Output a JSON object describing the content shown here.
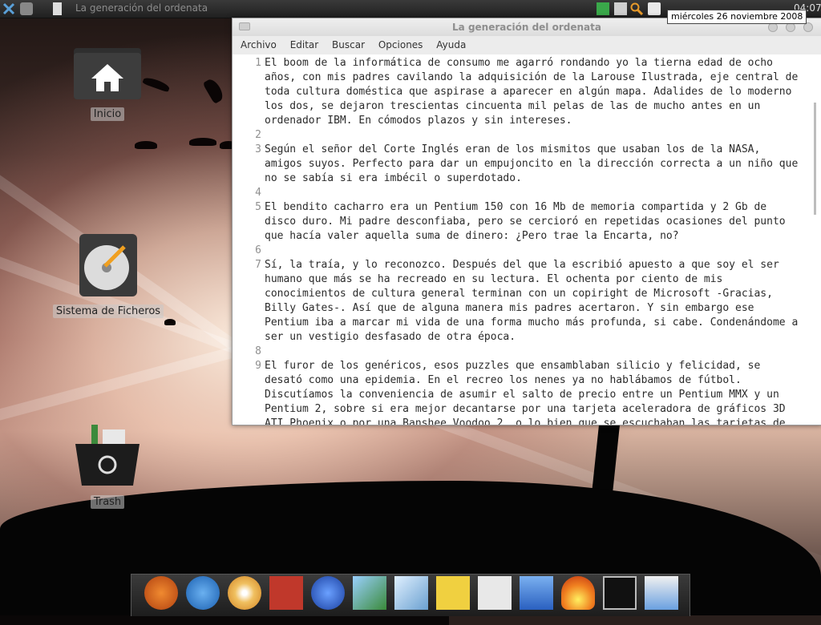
{
  "colors": {
    "panel_bg": "#2b2b2b",
    "editor_text_bg": "#ffffff",
    "line_number": "#8f8f8f"
  },
  "top_panel": {
    "task_title": "La generación del ordenata",
    "clock_tooltip": "miércoles 26 noviembre 2008",
    "clock_time": "04:07",
    "icons": [
      "x-menu-icon",
      "window-list-icon",
      "document-icon",
      "check-icon",
      "mail-icon",
      "search-icon",
      "rss-icon",
      "network-icon",
      "battery-icon"
    ]
  },
  "desktop": {
    "icons": [
      {
        "name": "home",
        "label": "Inicio",
        "icon": "home-folder-icon"
      },
      {
        "name": "filesystem",
        "label": "Sistema de Ficheros",
        "icon": "hard-drive-icon"
      },
      {
        "name": "trash",
        "label": "Trash",
        "icon": "trash-bin-icon"
      }
    ]
  },
  "editor": {
    "title": "La generación del ordenata",
    "menu": [
      "Archivo",
      "Editar",
      "Buscar",
      "Opciones",
      "Ayuda"
    ],
    "lines": [
      {
        "n": "1",
        "text": "El boom de la informática de consumo me agarró rondando yo la tierna edad de ocho años, con mis padres cavilando la adquisición de la Larouse Ilustrada, eje central de toda cultura doméstica que aspirase a aparecer en algún mapa. Adalides de lo moderno los dos, se dejaron trescientas cincuenta mil pelas de las de mucho antes en un ordenador IBM. En cómodos plazos y sin intereses."
      },
      {
        "n": "2",
        "text": ""
      },
      {
        "n": "3",
        "text": "Según el señor del Corte Inglés eran de los mismitos que usaban los de la NASA, amigos suyos. Perfecto para dar un empujoncito en la dirección correcta a un niño que no se sabía si era imbécil o superdotado."
      },
      {
        "n": "4",
        "text": ""
      },
      {
        "n": "5",
        "text": "El bendito cacharro era un Pentium 150 con 16 Mb de memoria compartida y 2 Gb de disco duro. Mi padre desconfiaba, pero se cercioró en repetidas ocasiones del punto que hacía valer aquella suma de dinero: ¿Pero trae la Encarta, no?"
      },
      {
        "n": "6",
        "text": ""
      },
      {
        "n": "7",
        "text": "Sí, la traía, y lo reconozco. Después del que la escribió apuesto a que soy el ser humano que más se ha recreado en su lectura. El ochenta por ciento de mis conocimientos de cultura general terminan con un copiright de Microsoft -Gracias, Billy Gates-. Así que de alguna manera mis padres acertaron. Y sin embargo ese Pentium iba a marcar mi vida de una forma mucho más profunda, si cabe. Condenándome a ser un vestigio desfasado de otra época."
      },
      {
        "n": "8",
        "text": ""
      },
      {
        "n": "9",
        "text": "El furor de los genéricos, esos puzzles que ensamblaban silicio y felicidad, se desató como una epidemia. En el recreo los nenes ya no hablábamos de fútbol. Discutíamos la conveniencia de asumir el salto de precio entre un Pentium MMX y un Pentium 2, sobre si era mejor decantarse por una tarjeta aceleradora de gráficos 3D ATI Phoenix o por una Banshee Voodoo 2, o lo bien que se escuchaban las tarjetas de"
      }
    ]
  },
  "dock": {
    "items": [
      "firefox-icon",
      "thunderbird-icon",
      "disc-burner-icon",
      "system-monitor-icon",
      "media-player-icon",
      "image-viewer-icon",
      "text-editor-icon",
      "notes-icon",
      "dictionary-icon",
      "download-icon",
      "flame-icon",
      "terminal-icon",
      "music-player-icon"
    ]
  }
}
